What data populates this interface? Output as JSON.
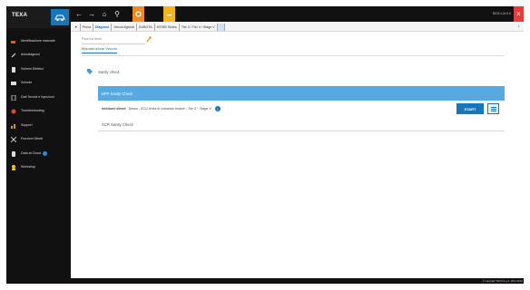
{
  "app": {
    "logo": "TEXA",
    "top_right_text": "IDC5 v.2x.0.0",
    "copyright": "© copyright TEXA S.p.A. 2011-2022"
  },
  "sidebar": {
    "items": [
      {
        "icon": "car-search-icon",
        "label": "Identificazione manuale"
      },
      {
        "icon": "wrench-icon",
        "label": "Autodiagnosi"
      },
      {
        "icon": "document-icon",
        "label": "Schemi Elettrici"
      },
      {
        "icon": "book-icon",
        "label": "Schede"
      },
      {
        "icon": "tablet-icon",
        "label": "Dati Tecnici e Ispezioni"
      },
      {
        "icon": "troubleshooting-icon",
        "label": "Troubleshooting"
      },
      {
        "icon": "chart-icon",
        "label": "Support"
      },
      {
        "icon": "scissors-icon",
        "label": "Funzioni Utenti"
      },
      {
        "icon": "car-icon",
        "label": "Data at Cloud",
        "badge": true
      },
      {
        "icon": "workshop-icon",
        "label": "Workshop"
      }
    ]
  },
  "breadcrumb": {
    "items": [
      "Prova",
      "Diagnosi",
      "Veicoli Agricoli",
      "KUBOTA",
      "M7060 Series",
      "Tier 3 / Tier 4 / Stage V",
      ""
    ]
  },
  "content": {
    "search_placeholder": "Ricerca testo",
    "tab": "Manutenzione Veicolo",
    "section_title": "Sanity check",
    "dpf_label": "DPF Sanity Check",
    "detail_label": "Iniezione diesel",
    "detail_text": "Denso - ECU Unità di comando motore - Tier 3 ~ Stage V",
    "start_label": "START",
    "scr_label": "SCR Sanity Check"
  },
  "colors": {
    "accent": "#1a74b8",
    "row_highlight": "#56a9e3",
    "orange": "#f08a24",
    "yellow": "#f3b51b",
    "close": "#e63b3b"
  }
}
